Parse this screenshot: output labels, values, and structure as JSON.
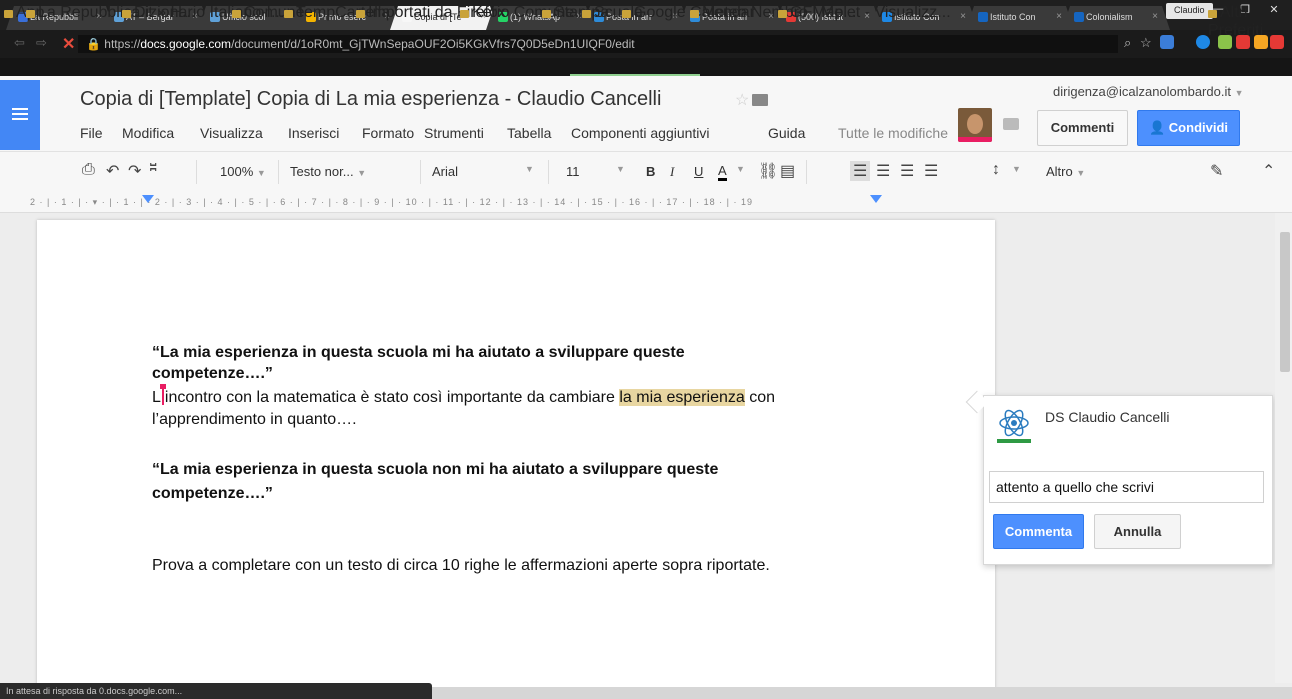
{
  "browser": {
    "tabs": [
      {
        "label": "La Repubbli",
        "color": "#3a6fd8"
      },
      {
        "label": "AT – Bergar",
        "color": "#5fa1d8"
      },
      {
        "label": "Ufficio scol",
        "color": "#5fa1d8"
      },
      {
        "label": "Primo eserc",
        "color": "#f4b400"
      },
      {
        "label": "Copia di [Te",
        "color": "#f7f7f7"
      },
      {
        "label": "(1) WhatsAp",
        "color": "#25d366"
      },
      {
        "label": "Posta in arr",
        "color": "#2e8bd8"
      },
      {
        "label": "Posta in arr",
        "color": "#2e8bd8"
      },
      {
        "label": "(500) Istitut",
        "color": "#e53935"
      },
      {
        "label": "Istituto Con",
        "color": "#1e88e5"
      },
      {
        "label": "Istituto Con",
        "color": "#1565c0"
      },
      {
        "label": "Colonialism",
        "color": "#1565c0"
      }
    ],
    "profile": "Claudio",
    "url_prefix": "https://",
    "url_host": "docs.google.com",
    "url_path": "/document/d/1oR0mt_GjTWnSepaOUF2Oi5KGkVfrs7Q0D5eDn1UIQF0/edit",
    "bookmarks": [
      "App",
      "La Repubblica.it » H...",
      "Dizionario Italiano-I...",
      "Comune",
      "TempCartella",
      "Importati da Firefox",
      "Kerio Comune",
      "Stampa",
      "Scuola",
      "Google Calendar",
      "Meteo Nembro | Me...",
      "GFMaplet - Visualizz...",
      "Altri Preferiti"
    ],
    "status": "In attesa di risposta da 0.docs.google.com..."
  },
  "doc": {
    "title": "Copia di [Template] Copia di La mia esperienza - Claudio Cancelli",
    "account": "dirigenza@icalzanolombardo.it",
    "menu": [
      "File",
      "Modifica",
      "Visualizza",
      "Inserisci",
      "Formato",
      "Strumenti",
      "Tabella",
      "Componenti aggiuntivi",
      "Guida"
    ],
    "changes": "Tutte le modifiche",
    "comments_btn": "Commenti",
    "share_btn": "Condividi"
  },
  "toolbar": {
    "zoom": "100%",
    "style": "Testo nor...",
    "font": "Arial",
    "size": "11",
    "bold": "B",
    "italic": "I",
    "underline": "U",
    "textcolor": "A",
    "more": "Altro"
  },
  "ruler": "2 · | · 1 · | · ▾ · | · 1 · | · 2 · | · 3 · | · 4 · | · 5 · | · 6 · | · 7 · | · 8 · | · 9 · | · 10 · | · 11 · | · 12 · | · 13 · | · 14 · | · 15 · | · 16 · | · 17 · | · 18 · | · 19",
  "content": {
    "heading1_a": "“La mia esperienza in questa scuola mi ha aiutato a sviluppare queste",
    "heading1_b": "competenze….”",
    "line1_pre": "L",
    "line1_mid": "incontro con la matematica è stato così importante da cambiare ",
    "line1_hl": "la mia esperienza",
    "line1_post": " con",
    "line2": "l’apprendimento in quanto….",
    "heading2_a": "“La mia esperienza in questa scuola non mi ha aiutato a sviluppare queste",
    "heading2_b": "competenze….”",
    "prompt": "Prova a completare con un testo di circa 10 righe le affermazioni aperte sopra riportate."
  },
  "comment": {
    "author": "DS Claudio Cancelli",
    "text": "attento a quello che scrivi",
    "submit": "Commenta",
    "cancel": "Annulla"
  },
  "colors": {
    "accent": "#4d90fe",
    "highlight": "#e8d6a1",
    "cursor": "#e91e63"
  }
}
